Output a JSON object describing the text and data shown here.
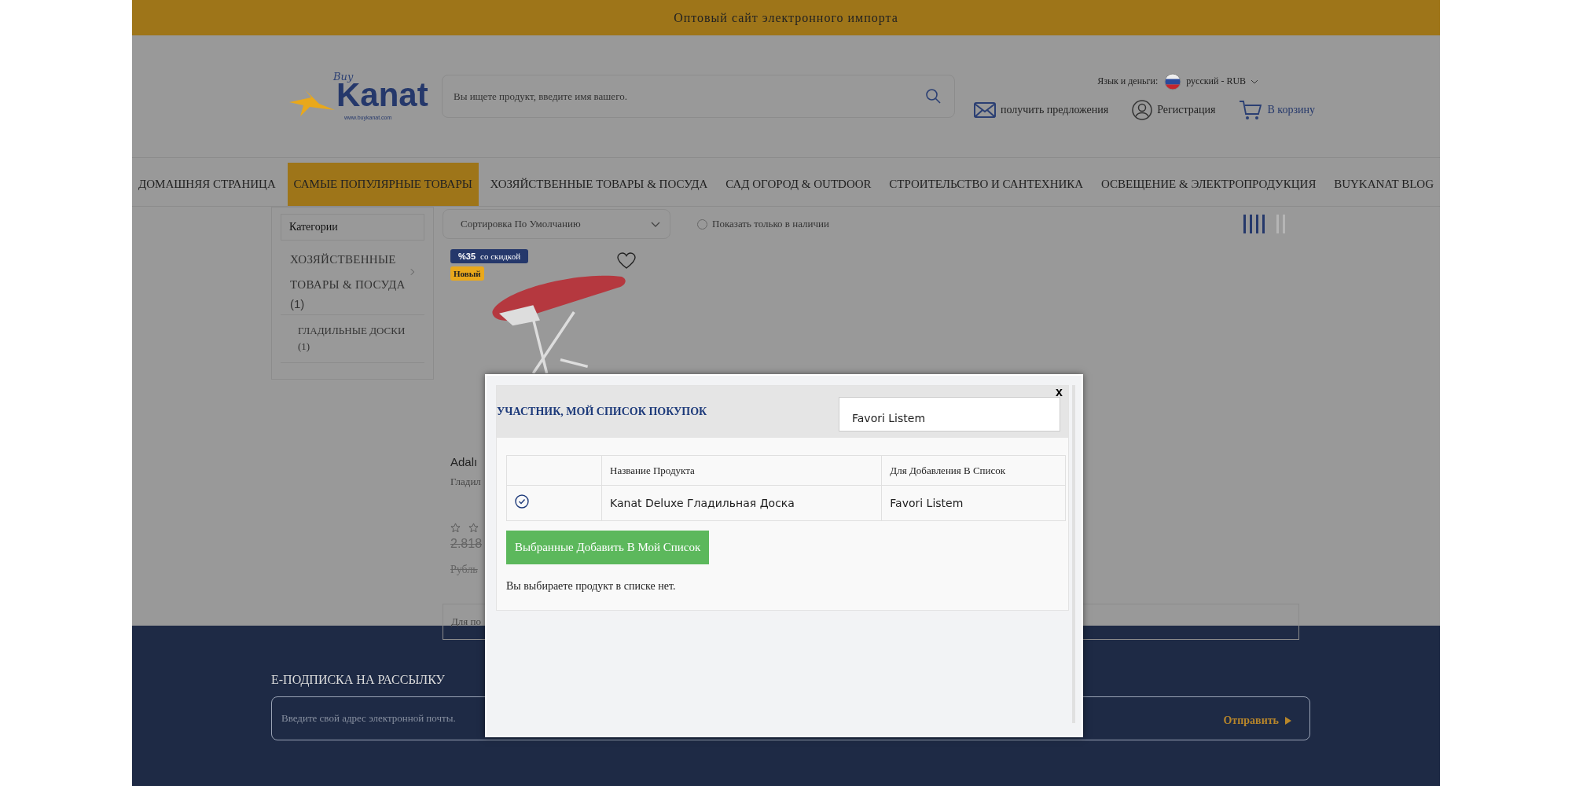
{
  "banner": {
    "text": "Оптовый сайт электронного импорта"
  },
  "header": {
    "logo": {
      "small": "Buy",
      "name": "Kanat",
      "url": "www.buykanat.com"
    },
    "search": {
      "placeholder": "Вы ищете продукт, введите имя вашего."
    },
    "locale": {
      "label": "Язык и деньги:",
      "value": "русский - RUB"
    },
    "actions": [
      {
        "kind": "mail",
        "label": "получить предложения"
      },
      {
        "kind": "user",
        "label": "Регистрация"
      },
      {
        "kind": "cart",
        "label": "В корзину"
      }
    ]
  },
  "nav": [
    {
      "label": "ДОМАШНЯЯ СТРАНИЦА",
      "selected": false
    },
    {
      "label": "САМЫЕ ПОПУЛЯРНЫЕ ТОВАРЫ",
      "selected": true
    },
    {
      "label": "ХОЗЯЙСТВЕННЫЕ ТОВАРЫ & ПОСУДА",
      "selected": false
    },
    {
      "label": "САД ОГОРОД & OUTDOOR",
      "selected": false
    },
    {
      "label": "СТРОИТЕЛЬСТВО И САНТЕХНИКА",
      "selected": false
    },
    {
      "label": "ОСВЕЩЕНИЕ & ЭЛЕКТРОПРОДУКЦИЯ",
      "selected": false
    },
    {
      "label": "BUYKANAT BLOG",
      "selected": false
    }
  ],
  "sidebar": {
    "title": "Категории",
    "categories": [
      {
        "label": "ХОЗЯЙСТВЕННЫЕ ТОВАРЫ & ПОСУДА",
        "count": "(1)",
        "children": [
          {
            "label": "ГЛАДИЛЬНЫЕ ДОСКИ",
            "count": "(1)"
          }
        ]
      }
    ]
  },
  "toolbar": {
    "sort": "Сортировка По Умолчанию",
    "in_stock": {
      "label": "Показать только в наличии",
      "checked": false
    },
    "views": [
      {
        "kind": "four",
        "selected": true
      },
      {
        "kind": "two",
        "selected": false
      }
    ]
  },
  "product": {
    "discount": "%35",
    "discount_text": "со скидкой",
    "badge": "Новый",
    "title": "Adalı",
    "subtitle": "Гладил",
    "old_price": "2.818",
    "currency": "Рубль",
    "note": "Для по"
  },
  "modal": {
    "close": "x",
    "title": "УЧАСТНИК, МОЙ СПИСОК ПОКУПОК",
    "list_select": "Favori Listem",
    "columns": [
      "Название Продукта",
      "Для Добавления В Список"
    ],
    "rows": [
      {
        "selected": true,
        "product": "Kanat Deluxe Гладильная Доска",
        "list": "Favori Listem"
      }
    ],
    "button": "Выбранные Добавить В Мой Список",
    "message": "Вы выбираете продукт в списке нет."
  },
  "footer": {
    "title": "E-ПОДПИСКА НА РАССЫЛКУ",
    "email_placeholder": "Введите свой адрес электронной почты.",
    "submit": "Отправить"
  }
}
